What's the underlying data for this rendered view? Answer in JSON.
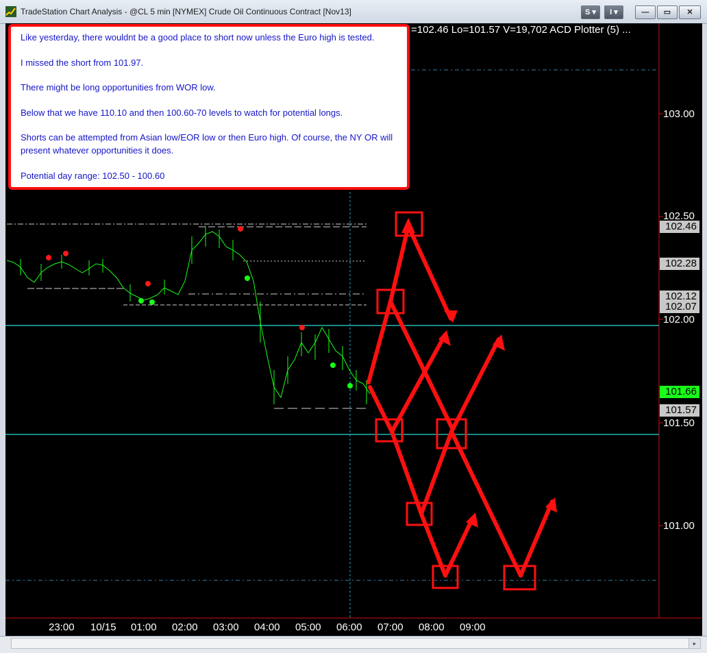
{
  "window": {
    "title": "TradeStation Chart Analysis - @CL 5 min [NYMEX] Crude Oil Continuous Contract [Nov13]",
    "buttons": {
      "s_label": "S",
      "i_label": "I",
      "minimize": "—",
      "restore": "▭",
      "close": "✕"
    }
  },
  "header": {
    "readout": "=102.46  Lo=101.57  V=19,702  ACD  Plotter (5)  ..."
  },
  "note": {
    "lines": [
      "Like yesterday, there wouldnt be a good place to short now unless the Euro high is tested.",
      "I missed the short from 101.97.",
      "There might be long opportunities from WOR low.",
      "Below that we have 110.10 and then 100.60-70 levels to watch for potential longs.",
      "Shorts can be attempted from Asian low/EOR low or then Euro high. Of course, the NY OR will present whatever opportunities it does.",
      "Potential day range: 102.50 - 100.60"
    ]
  },
  "price_axis": {
    "labels": [
      "103.00",
      "102.50",
      "102.00",
      "101.50",
      "101.00"
    ],
    "markers": [
      {
        "text": "102.46",
        "bg": "#c8c8c8"
      },
      {
        "text": "102.28",
        "bg": "#c8c8c8"
      },
      {
        "text": "102.12",
        "bg": "#c8c8c8"
      },
      {
        "text": "102.07",
        "bg": "#c8c8c8"
      },
      {
        "text": "101.66",
        "bg": "#19ff19"
      },
      {
        "text": "101.57",
        "bg": "#c8c8c8"
      }
    ]
  },
  "time_axis": {
    "labels": [
      "23:00",
      "10/15",
      "01:00",
      "02:00",
      "03:00",
      "04:00",
      "05:00",
      "06:00",
      "07:00",
      "08:00",
      "09:00"
    ]
  },
  "colors": {
    "accent_red": "#ff1010",
    "cyan_level": "#1fb8b0",
    "bars": "#19ff19",
    "note_text": "#1515c8"
  }
}
